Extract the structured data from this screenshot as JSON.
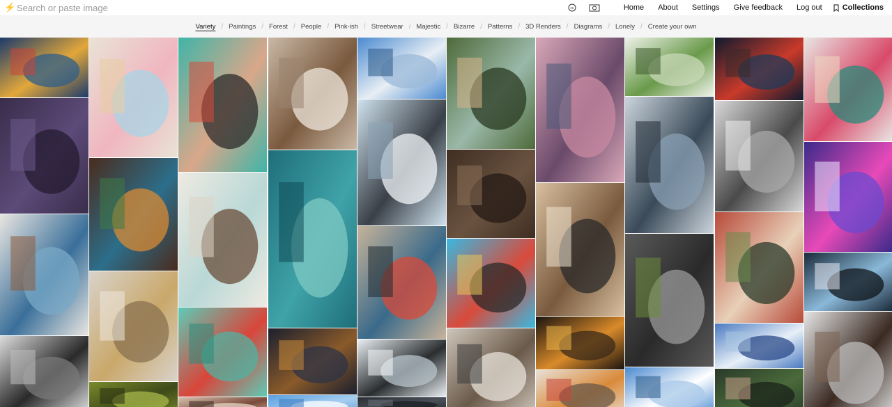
{
  "header": {
    "logo": "⚡",
    "search_placeholder": "Search or paste image",
    "icons": [
      "cc-icon",
      "camera-icon"
    ],
    "links": [
      "Home",
      "About",
      "Settings",
      "Give feedback",
      "Log out"
    ],
    "collections_label": "Collections"
  },
  "categories": {
    "active": "Variety",
    "items": [
      "Variety",
      "Paintings",
      "Forest",
      "People",
      "Pink-ish",
      "Streetwear",
      "Majestic",
      "Bizarre",
      "Patterns",
      "3D Renders",
      "Diagrams",
      "Lonely",
      "Create your own"
    ]
  },
  "gallery": {
    "columns": [
      [
        {
          "name": "starry-night-painting-image",
          "colors": [
            "#1b3a6b",
            "#e2a73a",
            "#2d5d8a",
            "#c9463a"
          ]
        },
        {
          "name": "purple-texture-image",
          "colors": [
            "#3a2d4b",
            "#5c4a78",
            "#241b30",
            "#6d5a8c"
          ]
        },
        {
          "name": "curved-interior-pool-image",
          "colors": [
            "#e9e6e1",
            "#3a6f9a",
            "#7aa9c7",
            "#8d5b3c"
          ]
        },
        {
          "name": "man-bw-portrait-image",
          "colors": [
            "#dcdcdc",
            "#2a2a2a",
            "#7a7a7a",
            "#bdbdbd"
          ]
        }
      ],
      [
        {
          "name": "stacked-teacups-image",
          "colors": [
            "#e9e3d6",
            "#f0b6c0",
            "#a8d4e6",
            "#e8cda2"
          ]
        },
        {
          "name": "glass-pendant-lamps-image",
          "colors": [
            "#4a2b1d",
            "#2c6e8a",
            "#d98a33",
            "#3e7a45"
          ]
        },
        {
          "name": "trombone-image",
          "colors": [
            "#d9d3cb",
            "#c9a86a",
            "#8a7250",
            "#efe8de"
          ]
        },
        {
          "name": "fly-closeup-image",
          "colors": [
            "#7a8a2a",
            "#3e4a1a",
            "#a8b84a",
            "#2a2e10"
          ]
        }
      ],
      [
        {
          "name": "cubist-cat-woman-portrait-image",
          "colors": [
            "#3fb5a8",
            "#d9a78a",
            "#2b2b2b",
            "#d94a3a"
          ]
        },
        {
          "name": "indoor-pool-room-image",
          "colors": [
            "#eeeae2",
            "#b9d8d6",
            "#6a4e3a",
            "#dcd4c6"
          ]
        },
        {
          "name": "red-truck-on-teal-image",
          "colors": [
            "#5ccbb7",
            "#d9453a",
            "#4fb3a2",
            "#2b8a7a"
          ]
        },
        {
          "name": "person-photo-image",
          "colors": [
            "#d8c2b0",
            "#7a4a3a",
            "#e8d8c8",
            "#3a2a20"
          ]
        }
      ],
      [
        {
          "name": "rocky-beach-shore-image",
          "colors": [
            "#c9b8a6",
            "#7a5a3e",
            "#efe7dc",
            "#9a8470"
          ]
        },
        {
          "name": "teal-marble-texture-image",
          "colors": [
            "#1f6e7a",
            "#3fa3a8",
            "#7fc9c4",
            "#0e4a56"
          ]
        },
        {
          "name": "night-road-landscape-image",
          "colors": [
            "#1a1f2e",
            "#8a5a2a",
            "#2e3346",
            "#c98a3a"
          ]
        },
        {
          "name": "blue-sky-clouds-image",
          "colors": [
            "#5aa0e0",
            "#a6cdf0",
            "#ffffff",
            "#3a7ac0"
          ]
        }
      ],
      [
        {
          "name": "white-tower-building-image",
          "colors": [
            "#4a8ad0",
            "#e8eef4",
            "#9ab8d8",
            "#2c5a8a"
          ]
        },
        {
          "name": "dancer-in-sheer-dress-image",
          "colors": [
            "#cfe2ee",
            "#3a4048",
            "#f2f6f8",
            "#8aa2b4"
          ]
        },
        {
          "name": "venice-gondola-canal-image",
          "colors": [
            "#c7b39a",
            "#3a6a8a",
            "#d94a3a",
            "#1f2a30"
          ]
        },
        {
          "name": "white-interior-window-image",
          "colors": [
            "#e9eef2",
            "#2a2e30",
            "#b8c4cc",
            "#f6f8fa"
          ]
        },
        {
          "name": "dark-photo-image",
          "colors": [
            "#2a2e34",
            "#4a5058",
            "#1a1d22",
            "#6a7078"
          ]
        }
      ],
      [
        {
          "name": "lake-island-house-image",
          "colors": [
            "#4e6a3a",
            "#9ab8a8",
            "#2a3a22",
            "#d9b48a"
          ]
        },
        {
          "name": "corduroy-pants-closeup-image",
          "colors": [
            "#3e2e22",
            "#6a5240",
            "#241a14",
            "#8a7058"
          ]
        },
        {
          "name": "collage-figure-on-blue-image",
          "colors": [
            "#3ab8e0",
            "#d94a3a",
            "#2a2a2a",
            "#e8c45a"
          ]
        },
        {
          "name": "packaging-boxes-image",
          "colors": [
            "#cfc6bb",
            "#6a5a4a",
            "#e8e2da",
            "#3a3a3a"
          ]
        }
      ],
      [
        {
          "name": "purse-with-coins-image",
          "colors": [
            "#d9a7b8",
            "#6a4a6a",
            "#c98aa2",
            "#4a5a7a"
          ]
        },
        {
          "name": "cafe-interior-image",
          "colors": [
            "#d8c0a0",
            "#7a5a3e",
            "#2a2a2a",
            "#efe3d0"
          ]
        },
        {
          "name": "city-lights-at-night-image",
          "colors": [
            "#1a1410",
            "#d98a2a",
            "#3a2a1a",
            "#f0b84a"
          ]
        },
        {
          "name": "skull-and-fruit-image",
          "colors": [
            "#e8e0d6",
            "#d98a3a",
            "#6a5a4a",
            "#c9453a"
          ]
        }
      ],
      [
        {
          "name": "hanging-plants-image",
          "colors": [
            "#eef2ea",
            "#6a9a4a",
            "#c9d8b8",
            "#3a5a2a"
          ]
        },
        {
          "name": "man-reflection-in-water-image",
          "colors": [
            "#cbd4dc",
            "#3a4a58",
            "#8aa0b4",
            "#1f2a34"
          ]
        },
        {
          "name": "steam-locomotive-smoke-image",
          "colors": [
            "#5a5a5a",
            "#2a2a2a",
            "#9a9a9a",
            "#6a8a3a"
          ]
        },
        {
          "name": "snowy-mountain-peak-image",
          "colors": [
            "#4a8ad0",
            "#ffffff",
            "#a8c8e8",
            "#2a5a8a"
          ]
        }
      ],
      [
        {
          "name": "dark-night-street-image",
          "colors": [
            "#0e1a2e",
            "#c93a2a",
            "#1f3a5a",
            "#3a2a2a"
          ]
        },
        {
          "name": "frosted-trees-bw-image",
          "colors": [
            "#d8d8d8",
            "#4a4a4a",
            "#a8a8a8",
            "#f0f0f0"
          ]
        },
        {
          "name": "red-colonial-building-image",
          "colors": [
            "#b84a3a",
            "#e8d0b8",
            "#2a3a2a",
            "#6a8a4a"
          ]
        },
        {
          "name": "cloudy-blue-sky-image",
          "colors": [
            "#4a7ac0",
            "#e8f0f8",
            "#2a4a8a",
            "#a8c4e0"
          ]
        },
        {
          "name": "green-dark-photo-image",
          "colors": [
            "#2a3a2a",
            "#4a6a3a",
            "#1a221a",
            "#c9a08a"
          ]
        }
      ],
      [
        {
          "name": "rose-paintings-on-wall-image",
          "colors": [
            "#e8e6e2",
            "#d94a6a",
            "#2a8a7a",
            "#f0d8c0"
          ]
        },
        {
          "name": "retro-computer-synthwave-image",
          "colors": [
            "#3a2a8a",
            "#e84ab8",
            "#6a4ad0",
            "#f0e8ff"
          ]
        },
        {
          "name": "concert-crowd-image",
          "colors": [
            "#1a2a3a",
            "#8ab8d8",
            "#0e141a",
            "#e8e8f0"
          ]
        },
        {
          "name": "modern-sideboard-image",
          "colors": [
            "#e6e6e6",
            "#3a2a22",
            "#bdbdbd",
            "#7a6050"
          ]
        }
      ]
    ]
  }
}
